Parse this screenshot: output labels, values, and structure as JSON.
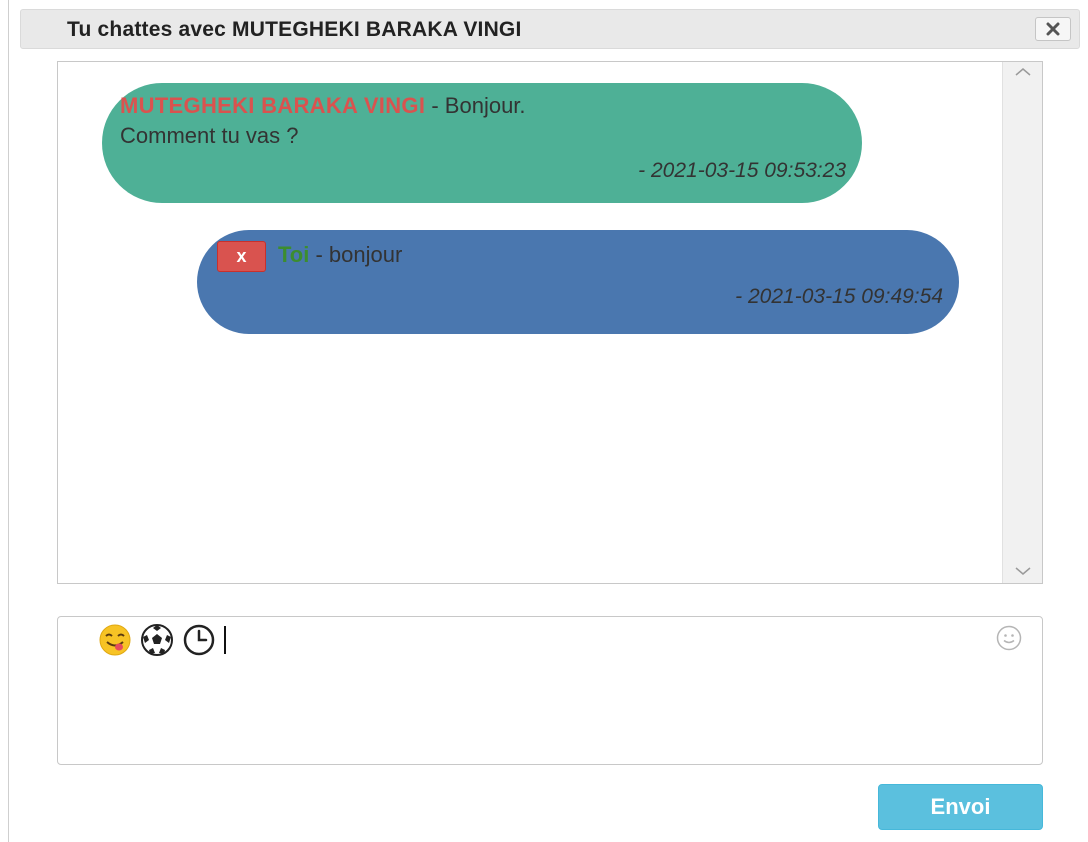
{
  "dialog": {
    "title": "Tu chattes avec MUTEGHEKI BARAKA VINGI",
    "close_icon": "close-icon"
  },
  "messages": [
    {
      "direction": "received",
      "author": "MUTEGHEKI BARAKA VINGI",
      "separator": " - ",
      "text_line1": "Bonjour.",
      "text_line2": "Comment tu vas ?",
      "timestamp": "- 2021-03-15 09:53:23"
    },
    {
      "direction": "sent",
      "delete_label": "x",
      "author": "Toi",
      "separator": " - ",
      "text_line1": "bonjour",
      "timestamp": "- 2021-03-15 09:49:54"
    }
  ],
  "compose": {
    "emojis": [
      "smiling-face-tongue-icon",
      "soccer-ball-icon",
      "clock-icon"
    ],
    "emoji_picker_icon": "smiley-face-icon"
  },
  "send_button": {
    "label": "Envoi"
  },
  "colors": {
    "received_bubble": "#4eb096",
    "sent_bubble": "#4a77af",
    "author_received": "#d9534f",
    "author_sent": "#3c8d2f",
    "delete_button": "#d9534f",
    "send_button": "#5bc0de",
    "titlebar": "#e9e9e9"
  }
}
